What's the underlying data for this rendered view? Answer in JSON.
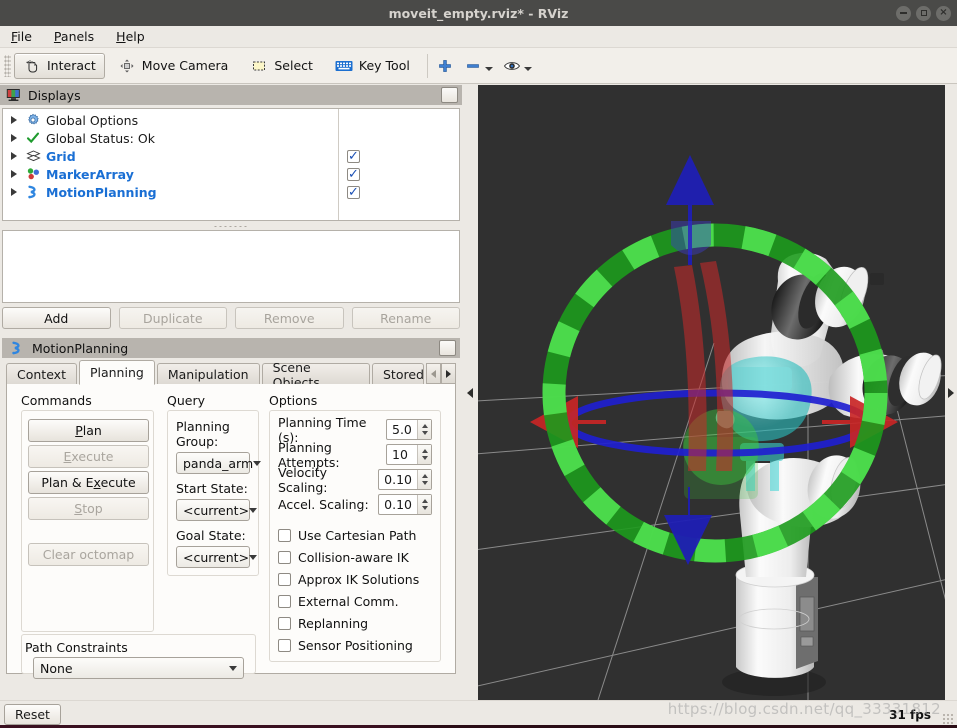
{
  "window": {
    "title": "moveit_empty.rviz* - RViz",
    "minimize_label": "–",
    "maximize_label": "□",
    "close_label": "×"
  },
  "menu": {
    "items": [
      {
        "label": "File",
        "mnemonic": "F",
        "rest": "ile"
      },
      {
        "label": "Panels",
        "mnemonic": "P",
        "rest": "anels"
      },
      {
        "label": "Help",
        "mnemonic": "H",
        "rest": "elp"
      }
    ]
  },
  "toolbar": {
    "interact": "Interact",
    "move_camera": "Move Camera",
    "select": "Select",
    "key_tool": "Key Tool",
    "add_tool_icon": "plus-icon",
    "remove_tool_icon": "minus-icon",
    "view_icon": "eye-icon"
  },
  "displays_panel": {
    "title": "Displays",
    "tree": [
      {
        "label": "Global Options",
        "icon": "gear-icon",
        "link": false,
        "has_checkbox": false,
        "checked": false
      },
      {
        "label": "Global Status: Ok",
        "icon": "check-icon",
        "link": false,
        "has_checkbox": false,
        "checked": false
      },
      {
        "label": "Grid",
        "icon": "grid-icon",
        "link": true,
        "has_checkbox": true,
        "checked": true
      },
      {
        "label": "MarkerArray",
        "icon": "markers-icon",
        "link": true,
        "has_checkbox": true,
        "checked": true
      },
      {
        "label": "MotionPlanning",
        "icon": "motionplanning-icon",
        "link": true,
        "has_checkbox": true,
        "checked": true
      }
    ],
    "checkmark": "✓",
    "buttons": [
      {
        "label": "Add",
        "enabled": true
      },
      {
        "label": "Duplicate",
        "enabled": false
      },
      {
        "label": "Remove",
        "enabled": false
      },
      {
        "label": "Rename",
        "enabled": false
      }
    ],
    "description_text": ""
  },
  "motion_planning": {
    "title": "MotionPlanning",
    "tabs": [
      {
        "label": "Context",
        "selected": false
      },
      {
        "label": "Planning",
        "selected": true
      },
      {
        "label": "Manipulation",
        "selected": false
      },
      {
        "label": "Scene Objects",
        "selected": false
      },
      {
        "label": "Stored",
        "selected": false,
        "clipped": true
      }
    ],
    "commands": {
      "heading": "Commands",
      "buttons": [
        {
          "label": "Plan",
          "mnemonic": "P",
          "pre": "",
          "post": "lan",
          "enabled": true
        },
        {
          "label": "Execute",
          "mnemonic": "E",
          "pre": "",
          "post": "xecute",
          "enabled": false
        },
        {
          "label": "Plan & Execute",
          "mnemonic": "x",
          "pre": "Plan & E",
          "post": "ecute",
          "enabled": true
        },
        {
          "label": "Stop",
          "mnemonic": "S",
          "pre": "",
          "post": "top",
          "enabled": false
        },
        {
          "label": "Clear octomap",
          "mnemonic": "",
          "pre": "Clear octomap",
          "post": "",
          "enabled": false
        }
      ]
    },
    "query": {
      "heading": "Query",
      "planning_group_label": "Planning Group:",
      "planning_group_value": "panda_arm",
      "start_state_label": "Start State:",
      "start_state_value": "<current>",
      "goal_state_label": "Goal State:",
      "goal_state_value": "<current>"
    },
    "options": {
      "heading": "Options",
      "spinners": [
        {
          "label": "Planning Time (s):",
          "value": "5.0"
        },
        {
          "label": "Planning Attempts:",
          "value": "10"
        },
        {
          "label": "Velocity Scaling:",
          "value": "0.10"
        },
        {
          "label": "Accel. Scaling:",
          "value": "0.10"
        }
      ],
      "checkboxes": [
        {
          "label": "Use Cartesian Path",
          "checked": false
        },
        {
          "label": "Collision-aware IK",
          "checked": false
        },
        {
          "label": "Approx IK Solutions",
          "checked": false
        },
        {
          "label": "External Comm.",
          "checked": false
        },
        {
          "label": "Replanning",
          "checked": false
        },
        {
          "label": "Sensor Positioning",
          "checked": false
        }
      ]
    },
    "path_constraints": {
      "heading": "Path Constraints",
      "value": "None"
    }
  },
  "viewport": {
    "background_color": "#303030",
    "grid_color": "#9a9a9a",
    "scene": "panda robot arm with interactive marker",
    "marker_ring_color": "#22a322",
    "arrow_x_color": "#c22222",
    "arrow_z_color": "#2222bb",
    "ring_xy_color": "#1f1fc8",
    "robot_color": "#f2f2f2",
    "ghost_color": "#3fd8d8"
  },
  "statusbar": {
    "reset_label": "Reset",
    "fps": "31 fps",
    "watermark": "https://blog.csdn.net/qq_33331812"
  }
}
